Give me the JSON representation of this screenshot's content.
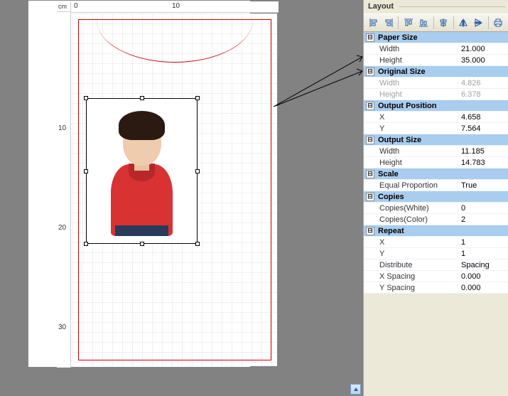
{
  "ruler": {
    "unit": "cm",
    "hTicks": [
      "0",
      "10"
    ],
    "vTicks": [
      "10",
      "20",
      "30"
    ]
  },
  "panel": {
    "title": "Layout",
    "sections": {
      "paperSize": {
        "label": "Paper Size",
        "width_label": "Width",
        "width": "21.000",
        "height_label": "Height",
        "height": "35.000"
      },
      "originalSize": {
        "label": "Original Size",
        "width_label": "Width",
        "width": "4.826",
        "height_label": "Height",
        "height": "6.378"
      },
      "outputPosition": {
        "label": "Output Position",
        "x_label": "X",
        "x": "4.658",
        "y_label": "Y",
        "y": "7.564"
      },
      "outputSize": {
        "label": "Output Size",
        "width_label": "Width",
        "width": "11.185",
        "height_label": "Height",
        "height": "14.783"
      },
      "scale": {
        "label": "Scale",
        "equal_label": "Equal Proportion",
        "equal": "True"
      },
      "copies": {
        "label": "Copies",
        "white_label": "Copies(White)",
        "white": "0",
        "color_label": "Copies(Color)",
        "color": "2"
      },
      "repeat": {
        "label": "Repeat",
        "x_label": "X",
        "x": "1",
        "y_label": "Y",
        "y": "1",
        "distribute_label": "Distribute",
        "distribute": "Spacing",
        "xspacing_label": "X Spacing",
        "xspacing": "0.000",
        "yspacing_label": "Y Spacing",
        "yspacing": "0.000"
      }
    }
  },
  "collapse_glyph": "⊟"
}
